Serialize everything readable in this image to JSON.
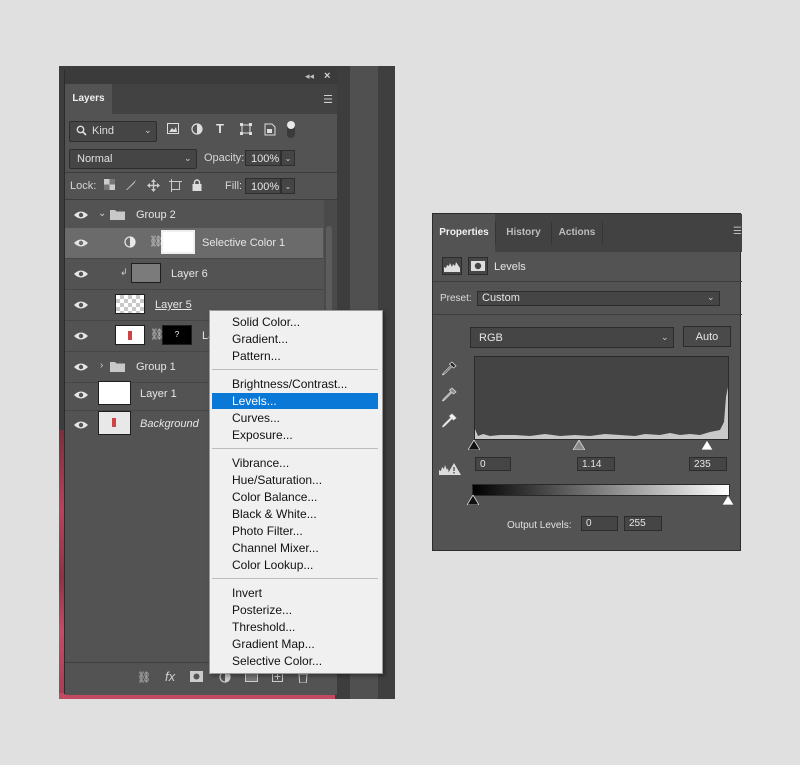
{
  "layers_panel": {
    "tab": "Layers",
    "filter": {
      "label": "Kind"
    },
    "blend_mode": "Normal",
    "opacity_label": "Opacity:",
    "opacity_value": "100%",
    "lock_label": "Lock:",
    "fill_label": "Fill:",
    "fill_value": "100%",
    "layers": [
      {
        "name": "Group 2",
        "type": "group",
        "expanded": true
      },
      {
        "name": "Selective Color 1",
        "type": "adjustment",
        "selected": true
      },
      {
        "name": "Layer 6",
        "type": "clipped"
      },
      {
        "name": "Layer 5",
        "type": "pixel"
      },
      {
        "name": "La",
        "type": "masked",
        "mask_label": "?"
      },
      {
        "name": "Group 1",
        "type": "group",
        "expanded": false
      },
      {
        "name": "Layer 1",
        "type": "pixel"
      },
      {
        "name": "Background",
        "type": "background"
      }
    ],
    "footer_icons": [
      "link-icon",
      "fx-icon",
      "mask-icon",
      "adjustment-icon",
      "folder-icon",
      "new-layer-icon",
      "trash-icon"
    ]
  },
  "context_menu": {
    "groups": [
      [
        "Solid Color...",
        "Gradient...",
        "Pattern..."
      ],
      [
        "Brightness/Contrast...",
        "Levels...",
        "Curves...",
        "Exposure..."
      ],
      [
        "Vibrance...",
        "Hue/Saturation...",
        "Color Balance...",
        "Black & White...",
        "Photo Filter...",
        "Channel Mixer...",
        "Color Lookup..."
      ],
      [
        "Invert",
        "Posterize...",
        "Threshold...",
        "Gradient Map...",
        "Selective Color..."
      ]
    ],
    "highlighted": "Levels..."
  },
  "properties_panel": {
    "tabs": [
      "Properties",
      "History",
      "Actions"
    ],
    "active_tab": "Properties",
    "subtitle": "Levels",
    "preset_label": "Preset:",
    "preset_value": "Custom",
    "channel": "RGB",
    "auto_label": "Auto",
    "input_black": "0",
    "input_gamma": "1.14",
    "input_white": "235",
    "output_label": "Output Levels:",
    "output_black": "0",
    "output_white": "255"
  },
  "colors": {
    "panel_bg": "#535353",
    "highlight": "#0a78d7",
    "menu_bg": "#f0f0f0"
  }
}
